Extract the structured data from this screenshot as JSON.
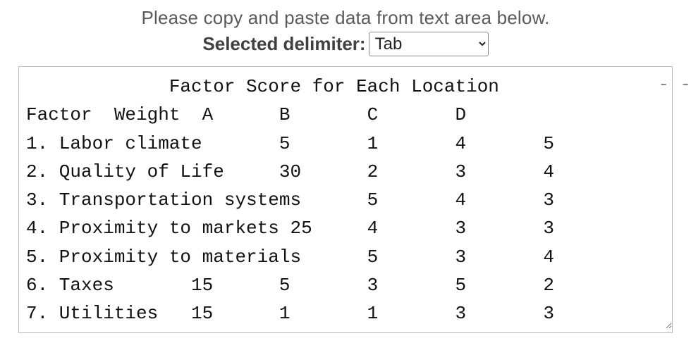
{
  "instruction": "Please copy and paste data from text area below.",
  "delimiter": {
    "label": "Selected delimiter:",
    "selected": "Tab",
    "options": [
      "Tab"
    ]
  },
  "textarea_lines": [
    "             Factor Score for Each Location",
    "Factor  Weight  A      B       C       D",
    "1. Labor climate       5       1       4       5",
    "2. Quality of Life     30      2       3       4",
    "3. Transportation systems      5       4       3",
    "4. Proximity to markets 25     4       3       3",
    "5. Proximity to materials      5       3       4",
    "6. Taxes       15      5       3       5       2",
    "7. Utilities   15      1       1       3       3"
  ],
  "right_dashes": "-\n-"
}
